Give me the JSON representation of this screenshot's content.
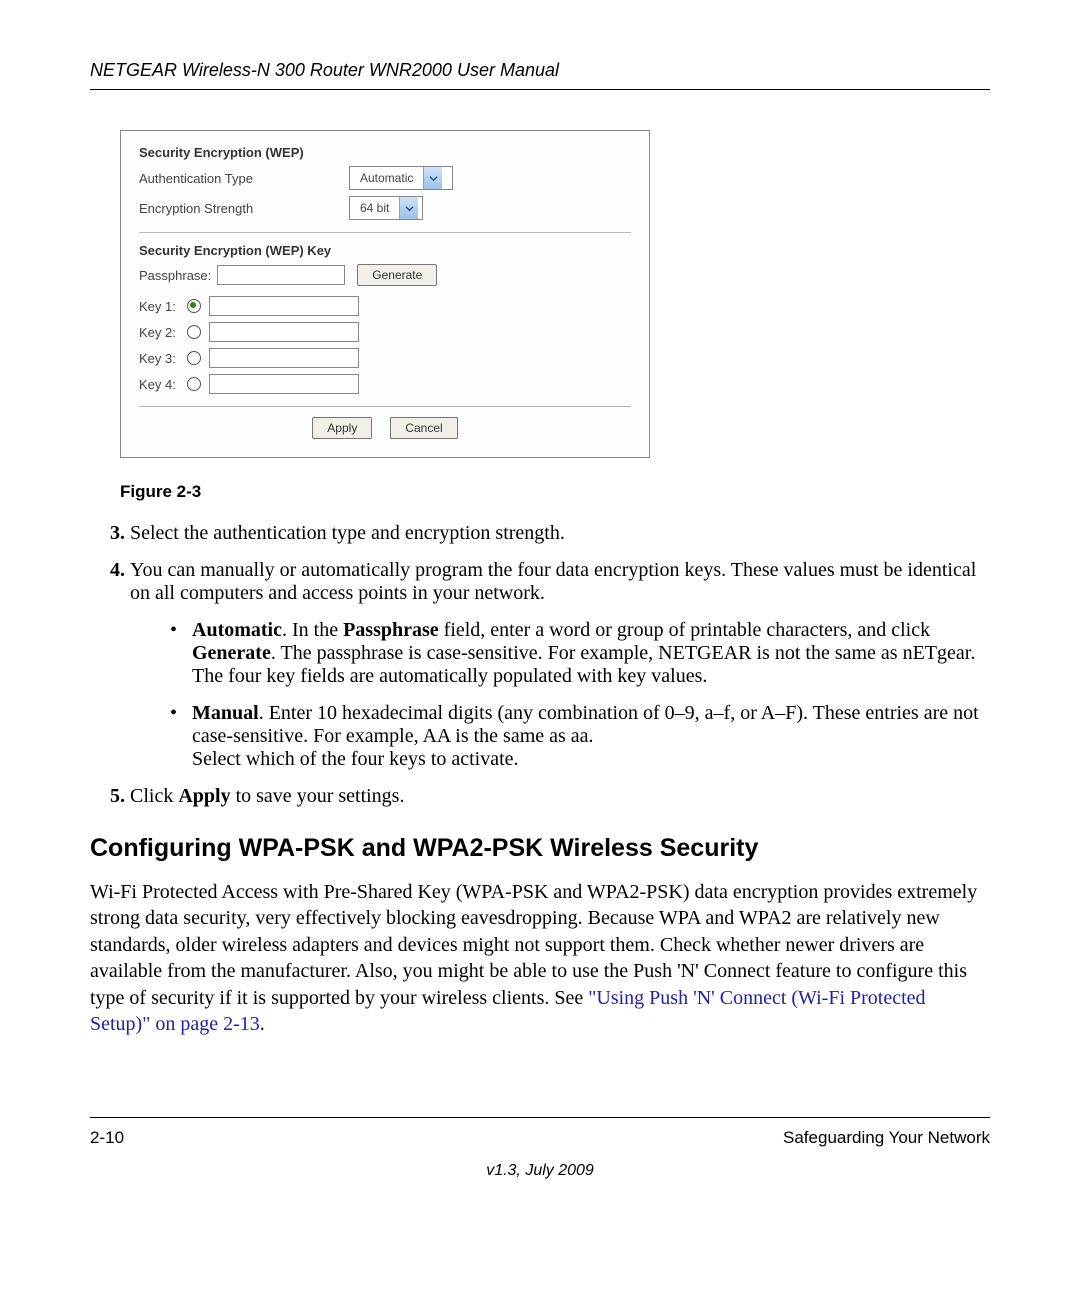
{
  "header": {
    "title": "NETGEAR Wireless-N 300 Router WNR2000 User Manual"
  },
  "shot": {
    "sect1": "Security Encryption (WEP)",
    "authLabel": "Authentication Type",
    "authValue": "Automatic",
    "encLabel": "Encryption Strength",
    "encValue": "64 bit",
    "sect2": "Security Encryption (WEP) Key",
    "passLabel": "Passphrase:",
    "generate": "Generate",
    "keys": [
      "Key 1:",
      "Key 2:",
      "Key 3:",
      "Key 4:"
    ],
    "apply": "Apply",
    "cancel": "Cancel"
  },
  "figureLabel": "Figure 2-3",
  "steps": {
    "s3": "Select the authentication type and encryption strength.",
    "s4": "You can manually or automatically program the four data encryption keys. These values must be identical on all computers and access points in your network.",
    "bullet1a": "Automatic",
    "bullet1b": ". In the ",
    "bullet1c": "Passphrase",
    "bullet1d": " field, enter a word or group of printable characters, and click ",
    "bullet1e": "Generate",
    "bullet1f": ". The passphrase is case-sensitive. For example, NETGEAR is not the same as nETgear. The four key fields are automatically populated with key values.",
    "bullet2a": "Manual",
    "bullet2b": ". Enter 10 hexadecimal digits (any combination of 0–9, a–f, or A–F). These entries are not case-sensitive. For example, AA is the same as aa.",
    "bullet2c": "Select which of the four keys to activate.",
    "s5a": "Click ",
    "s5b": "Apply",
    "s5c": " to save your settings."
  },
  "sectionHeading": "Configuring WPA-PSK and WPA2-PSK Wireless Security",
  "wpaPara1": "Wi-Fi Protected Access with Pre-Shared Key (WPA-PSK and WPA2-PSK) data encryption provides extremely strong data security, very effectively blocking eavesdropping. Because WPA and WPA2 are relatively new standards, older wireless adapters and devices might not support them. Check whether newer drivers are available from the manufacturer. Also, you might be able to use the Push 'N' Connect feature to configure this type of security if it is supported by your wireless clients. See ",
  "wpaLink": "\"Using Push 'N' Connect (Wi-Fi Protected Setup)\" on page 2-13",
  "wpaPara2": ".",
  "footer": {
    "pageNum": "2-10",
    "chapter": "Safeguarding Your Network",
    "version": "v1.3, July 2009"
  }
}
